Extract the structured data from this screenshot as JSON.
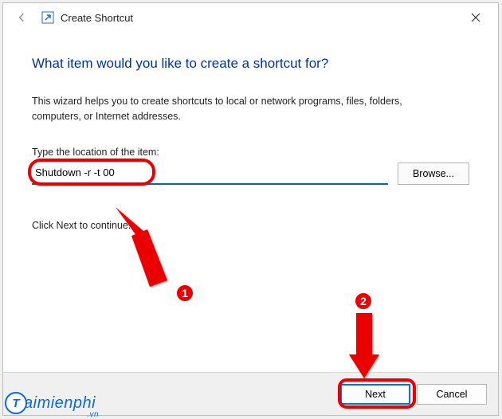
{
  "window": {
    "title": "Create Shortcut"
  },
  "main": {
    "heading": "What item would you like to create a shortcut for?",
    "description": "This wizard helps you to create shortcuts to local or network programs, files, folders, computers, or Internet addresses.",
    "field_label": "Type the location of the item:",
    "location_value": "Shutdown -r -t 00",
    "browse_label": "Browse...",
    "continue_hint": "Click Next to continue."
  },
  "footer": {
    "next_label": "Next",
    "cancel_label": "Cancel"
  },
  "annotations": {
    "badge1": "1",
    "badge2": "2"
  },
  "watermark": {
    "letter": "T",
    "text": "aimienphi",
    "suffix": ".vn"
  }
}
